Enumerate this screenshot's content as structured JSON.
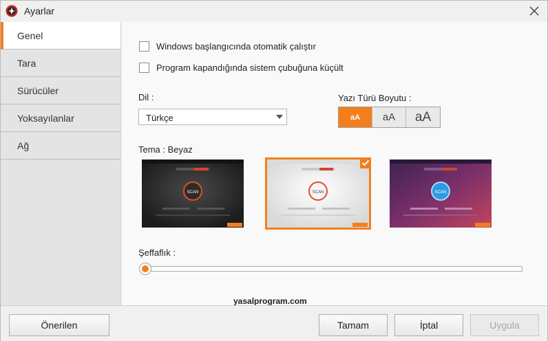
{
  "window": {
    "title": "Ayarlar"
  },
  "sidebar": {
    "items": [
      {
        "label": "Genel",
        "active": true
      },
      {
        "label": "Tara"
      },
      {
        "label": "Sürücüler"
      },
      {
        "label": "Yoksayılanlar"
      },
      {
        "label": "Ağ"
      }
    ]
  },
  "general": {
    "startup_checkbox": "Windows başlangıcında otomatik çalıştır",
    "tray_checkbox": "Program kapandığında sistem çubuğuna küçült",
    "language_label": "Dil :",
    "language_value": "Türkçe",
    "font_size_label": "Yazı Türü Boyutu :",
    "font_sizes": [
      "aA",
      "aA",
      "aA"
    ],
    "theme_label": "Tema : Beyaz",
    "transparency_label": "Şeffaflık :",
    "transparency_value": 0
  },
  "themes": [
    {
      "bg": "#262626",
      "ring": "#e64a2e",
      "scan": "SCAN"
    },
    {
      "bg": "#ececec",
      "ring": "#e64a2e",
      "scan": "SCAN",
      "selected": true
    },
    {
      "bg": "#5b2b62",
      "ring": "#2d9be0",
      "scan": "SCAN"
    }
  ],
  "watermark": "yasalprogram.com",
  "footer": {
    "recommended": "Önerilen",
    "ok": "Tamam",
    "cancel": "İptal",
    "apply": "Uygula"
  },
  "colors": {
    "accent": "#f27f1b"
  }
}
